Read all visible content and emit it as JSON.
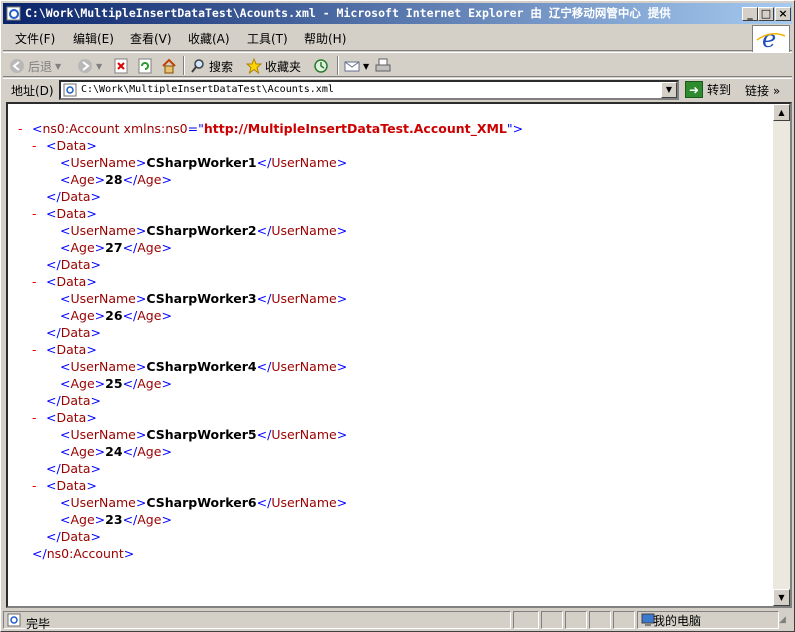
{
  "window": {
    "title": "C:\\Work\\MultipleInsertDataTest\\Acounts.xml - Microsoft Internet Explorer 由 辽宁移动网管中心 提供",
    "minimize": "_",
    "maximize": "□",
    "close": "×"
  },
  "menu": [
    {
      "label": "文件(F)"
    },
    {
      "label": "编辑(E)"
    },
    {
      "label": "查看(V)"
    },
    {
      "label": "收藏(A)"
    },
    {
      "label": "工具(T)"
    },
    {
      "label": "帮助(H)"
    }
  ],
  "toolbar": {
    "back_label": "后退",
    "search_label": "搜索",
    "favorites_label": "收藏夹"
  },
  "address": {
    "label": "地址(D)",
    "value": "C:\\Work\\MultipleInsertDataTest\\Acounts.xml",
    "go_label": "转到",
    "links_label": "链接",
    "links_more": "»"
  },
  "xml": {
    "root_tag": "ns0:Account",
    "root_attr_name": "xmlns:ns0",
    "root_attr_value": "http://MultipleInsertDataTest.Account_XML",
    "record_tag": "Data",
    "field1_tag": "UserName",
    "field2_tag": "Age",
    "records": [
      {
        "username": "CSharpWorker1",
        "age": "28"
      },
      {
        "username": "CSharpWorker2",
        "age": "27"
      },
      {
        "username": "CSharpWorker3",
        "age": "26"
      },
      {
        "username": "CSharpWorker4",
        "age": "25"
      },
      {
        "username": "CSharpWorker5",
        "age": "24"
      },
      {
        "username": "CSharpWorker6",
        "age": "23"
      }
    ]
  },
  "status": {
    "text": "完毕",
    "zone": "我的电脑"
  }
}
